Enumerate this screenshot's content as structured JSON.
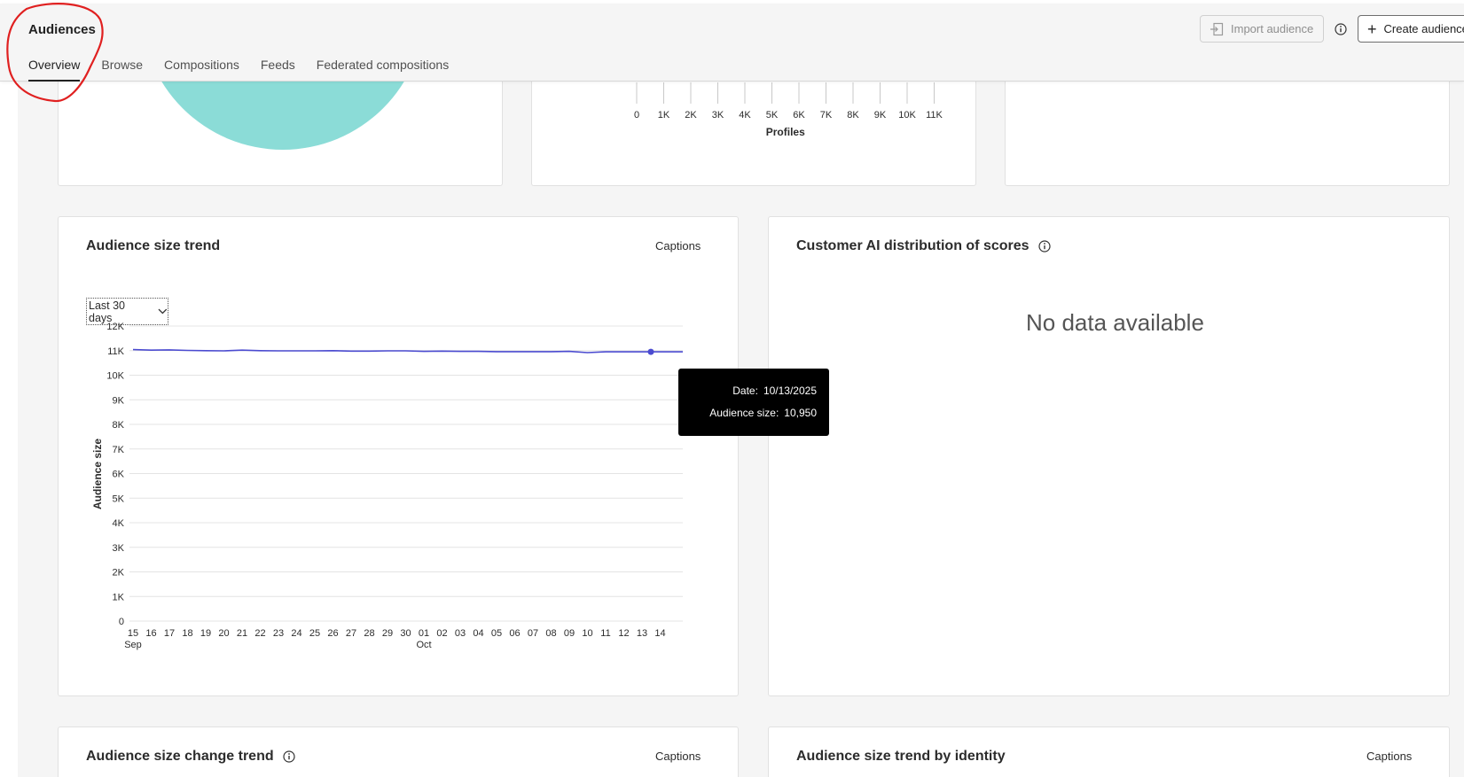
{
  "header": {
    "title": "Audiences",
    "tabs": [
      {
        "label": "Overview",
        "active": true
      },
      {
        "label": "Browse"
      },
      {
        "label": "Compositions"
      },
      {
        "label": "Feeds"
      },
      {
        "label": "Federated compositions"
      }
    ],
    "import_label": "Import audience",
    "create_label": "Create audience"
  },
  "top_histogram": {
    "ticks": [
      "0",
      "1K",
      "2K",
      "3K",
      "4K",
      "5K",
      "6K",
      "7K",
      "8K",
      "9K",
      "10K",
      "11K"
    ],
    "xlabel": "Profiles"
  },
  "size_trend": {
    "title": "Audience size trend",
    "captions": "Captions",
    "range": "Last 30 days",
    "tooltip": {
      "date_label": "Date:",
      "date_value": "10/13/2025",
      "size_label": "Audience size:",
      "size_value": "10,950"
    }
  },
  "customer_ai": {
    "title": "Customer AI distribution of scores",
    "empty": "No data available"
  },
  "change_trend": {
    "title": "Audience size change trend",
    "captions": "Captions"
  },
  "identity_trend": {
    "title": "Audience size trend by identity",
    "captions": "Captions"
  },
  "colors": {
    "accent": "#4b4bd0",
    "teal": "#8bdcd7",
    "annotation": "#e02020"
  },
  "chart_data": {
    "type": "line",
    "ylabel": "Audience size",
    "ylim": [
      0,
      12000
    ],
    "yticks": [
      "0",
      "1K",
      "2K",
      "3K",
      "4K",
      "5K",
      "6K",
      "7K",
      "8K",
      "9K",
      "10K",
      "11K",
      "12K"
    ],
    "x": [
      "15",
      "16",
      "17",
      "18",
      "19",
      "20",
      "21",
      "22",
      "23",
      "24",
      "25",
      "26",
      "27",
      "28",
      "29",
      "30",
      "01",
      "02",
      "03",
      "04",
      "05",
      "06",
      "07",
      "08",
      "09",
      "10",
      "11",
      "12",
      "13",
      "14"
    ],
    "month_labels": [
      {
        "index": 0,
        "label": "Sep"
      },
      {
        "index": 16,
        "label": "Oct"
      }
    ],
    "series": [
      {
        "values": [
          11040,
          11020,
          11030,
          11010,
          11000,
          10990,
          11020,
          11000,
          10990,
          10990,
          10990,
          11000,
          10980,
          10980,
          10990,
          10990,
          10970,
          10980,
          10970,
          10970,
          10960,
          10960,
          10960,
          10960,
          10970,
          10920,
          10950,
          10950,
          10950,
          10950
        ]
      }
    ],
    "highlight_index": 28
  }
}
